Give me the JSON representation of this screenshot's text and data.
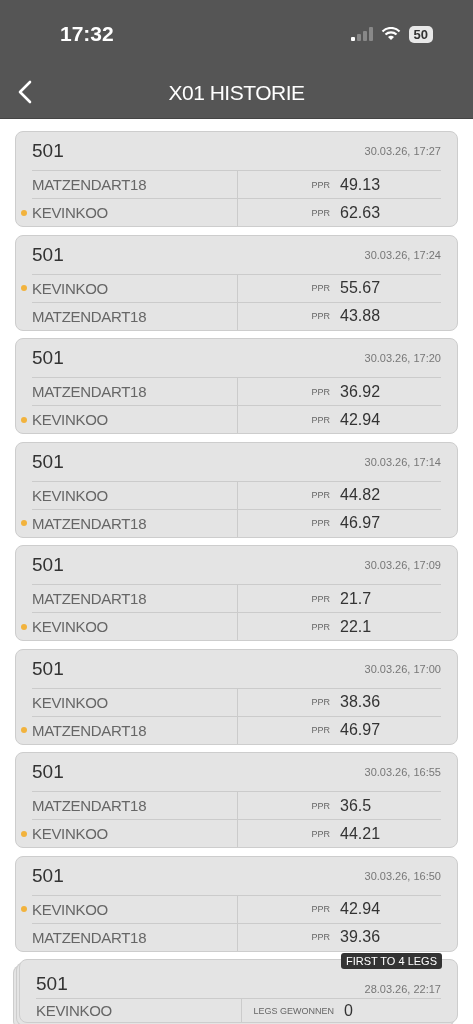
{
  "status_bar": {
    "time": "17:32",
    "battery": "50"
  },
  "header": {
    "title": "X01 HISTORIE"
  },
  "matches": [
    {
      "kind": "game",
      "title": "501",
      "date": "30.03.26, 17:27",
      "players": [
        {
          "name": "MATZENDART18",
          "winner": false,
          "stat_label": "PPR",
          "value": "49.13"
        },
        {
          "name": "KEVINKOO",
          "winner": true,
          "stat_label": "PPR",
          "value": "62.63"
        }
      ]
    },
    {
      "kind": "game",
      "title": "501",
      "date": "30.03.26, 17:24",
      "players": [
        {
          "name": "KEVINKOO",
          "winner": true,
          "stat_label": "PPR",
          "value": "55.67"
        },
        {
          "name": "MATZENDART18",
          "winner": false,
          "stat_label": "PPR",
          "value": "43.88"
        }
      ]
    },
    {
      "kind": "game",
      "title": "501",
      "date": "30.03.26, 17:20",
      "players": [
        {
          "name": "MATZENDART18",
          "winner": false,
          "stat_label": "PPR",
          "value": "36.92"
        },
        {
          "name": "KEVINKOO",
          "winner": true,
          "stat_label": "PPR",
          "value": "42.94"
        }
      ]
    },
    {
      "kind": "game",
      "title": "501",
      "date": "30.03.26, 17:14",
      "players": [
        {
          "name": "KEVINKOO",
          "winner": false,
          "stat_label": "PPR",
          "value": "44.82"
        },
        {
          "name": "MATZENDART18",
          "winner": true,
          "stat_label": "PPR",
          "value": "46.97"
        }
      ]
    },
    {
      "kind": "game",
      "title": "501",
      "date": "30.03.26, 17:09",
      "players": [
        {
          "name": "MATZENDART18",
          "winner": false,
          "stat_label": "PPR",
          "value": "21.7"
        },
        {
          "name": "KEVINKOO",
          "winner": true,
          "stat_label": "PPR",
          "value": "22.1"
        }
      ]
    },
    {
      "kind": "game",
      "title": "501",
      "date": "30.03.26, 17:00",
      "players": [
        {
          "name": "KEVINKOO",
          "winner": false,
          "stat_label": "PPR",
          "value": "38.36"
        },
        {
          "name": "MATZENDART18",
          "winner": true,
          "stat_label": "PPR",
          "value": "46.97"
        }
      ]
    },
    {
      "kind": "game",
      "title": "501",
      "date": "30.03.26, 16:55",
      "players": [
        {
          "name": "MATZENDART18",
          "winner": false,
          "stat_label": "PPR",
          "value": "36.5"
        },
        {
          "name": "KEVINKOO",
          "winner": true,
          "stat_label": "PPR",
          "value": "44.21"
        }
      ]
    },
    {
      "kind": "game",
      "title": "501",
      "date": "30.03.26, 16:50",
      "players": [
        {
          "name": "KEVINKOO",
          "winner": true,
          "stat_label": "PPR",
          "value": "42.94"
        },
        {
          "name": "MATZENDART18",
          "winner": false,
          "stat_label": "PPR",
          "value": "39.36"
        }
      ]
    },
    {
      "kind": "match",
      "badge": "FIRST TO 4 LEGS",
      "title": "501",
      "date": "28.03.26, 22:17",
      "players": [
        {
          "name": "KEVINKOO",
          "winner": false,
          "stat_label": "LEGS GEWONNEN",
          "value": "0"
        }
      ]
    }
  ]
}
